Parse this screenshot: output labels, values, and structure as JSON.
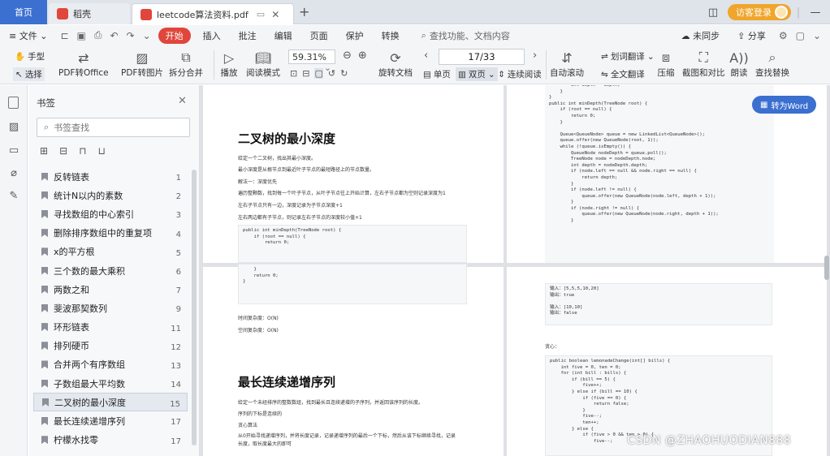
{
  "tabs": {
    "home": "首页",
    "wps": "稻壳",
    "doc": "leetcode算法资料.pdf",
    "add": "+"
  },
  "window": {
    "login": "访客登录"
  },
  "menu": {
    "file": "文件",
    "start": "开始",
    "insert": "插入",
    "annotate": "批注",
    "edit": "编辑",
    "page": "页面",
    "protect": "保护",
    "convert": "转换",
    "search": "查找功能、文档内容",
    "sync": "未同步",
    "share": "分享"
  },
  "toolbar": {
    "hand": "手型",
    "select": "选择",
    "pdf_office": "PDF转Office",
    "pdf_image": "PDF转图片",
    "split_merge": "拆分合并",
    "play": "播放",
    "read_mode": "阅读模式",
    "zoom": "59.31%",
    "rotate": "旋转文档",
    "page_indicator": "17/33",
    "single": "单页",
    "double": "双页",
    "continuous": "连续阅读",
    "auto_scroll": "自动滚动",
    "translate": "划词翻译",
    "full_translate": "全文翻译",
    "compress": "压缩",
    "screenshot": "截图和对比",
    "read_aloud": "朗读",
    "find_replace": "查找替换"
  },
  "panel": {
    "title": "书签",
    "search_placeholder": "书签查找",
    "bookmarks": [
      {
        "label": "反转链表",
        "num": "1"
      },
      {
        "label": "统计N以内的素数",
        "num": "2"
      },
      {
        "label": "寻找数组的中心索引",
        "num": "3"
      },
      {
        "label": "删除排序数组中的重复项",
        "num": "4"
      },
      {
        "label": "x的平方根",
        "num": "5"
      },
      {
        "label": "三个数的最大乘积",
        "num": "6"
      },
      {
        "label": "两数之和",
        "num": "7"
      },
      {
        "label": "斐波那契数列",
        "num": "9"
      },
      {
        "label": "环形链表",
        "num": "11"
      },
      {
        "label": "排列硬币",
        "num": "12"
      },
      {
        "label": "合并两个有序数组",
        "num": "13"
      },
      {
        "label": "子数组最大平均数",
        "num": "14"
      },
      {
        "label": "二叉树的最小深度",
        "num": "15"
      },
      {
        "label": "最长连续递增序列",
        "num": "17"
      },
      {
        "label": "柠檬水找零",
        "num": "17"
      }
    ]
  },
  "doc": {
    "to_word": "转为Word",
    "p1": {
      "title": "二叉树的最小深度",
      "lines": [
        "给定一个二叉树，找出其最小深度。",
        "最小深度是从根节点到最近叶子节点的最短路径上的节点数量。",
        "解法一：深度优先",
        "遍历整颗数，找到每一个叶子节点，从叶子节点往上开始计算，左右子节点都为空则记录深度为1",
        "左右子节点只有一边，深度记录为子节点深度+1",
        "左右两边都有子节点，则记录左右子节点的深度较小值+1"
      ],
      "code": "public int minDepth(TreeNode root) {\n    if (root == null) {\n        return 0;"
    },
    "p2": {
      "code": "        int depth = depth;\n    }\n}\npublic int minDepth(TreeNode root) {\n    if (root == null) {\n        return 0;\n    }\n\n    Queue<QueueNode> queue = new LinkedList<QueueNode>();\n    queue.offer(new QueueNode(root, 1));\n    while (!queue.isEmpty()) {\n        QueueNode nodeDepth = queue.poll();\n        TreeNode node = nodeDepth.node;\n        int depth = nodeDepth.depth;\n        if (node.left == null && node.right == null) {\n            return depth;\n        }\n        if (node.left != null) {\n            queue.offer(new QueueNode(node.left, depth + 1));\n        }\n        if (node.right != null) {\n            queue.offer(new QueueNode(node.right, depth + 1));\n        }"
    },
    "p3": {
      "code": "    }\n    return 0;\n}",
      "time": "时间复杂度：O(N)",
      "space": "空间复杂度：O(N)",
      "title": "最长连续递增序列",
      "lines": [
        "给定一个未经排序的整数数组，找到最长且连续递增的子序列，并返回该序列的长度。",
        "序列的下标是连续的",
        "贪心算法",
        "从0开始寻找递增序列，并将长度记录，记录递增序列的最后一个下标，然后从该下标继续寻找，记录",
        "长度，取长度最大的即可"
      ]
    },
    "p4": {
      "example": "输入：[5,5,5,10,20]\n输出：true\n\n输入：[10,10]\n输出：false",
      "greedy": "贪心：",
      "code": "public boolean lemonadeChange(int[] bills) {\n    int five = 0, ten = 0;\n    for (int bill : bills) {\n        if (bill == 5) {\n            five++;\n        } else if (bill == 10) {\n            if (five == 0) {\n                return false;\n            }\n            five--;\n            ten++;\n        } else {\n            if (five > 0 && ten > 0) {\n                five--;"
    }
  },
  "watermark": "CSDN @ZHAOHUODIAN888"
}
